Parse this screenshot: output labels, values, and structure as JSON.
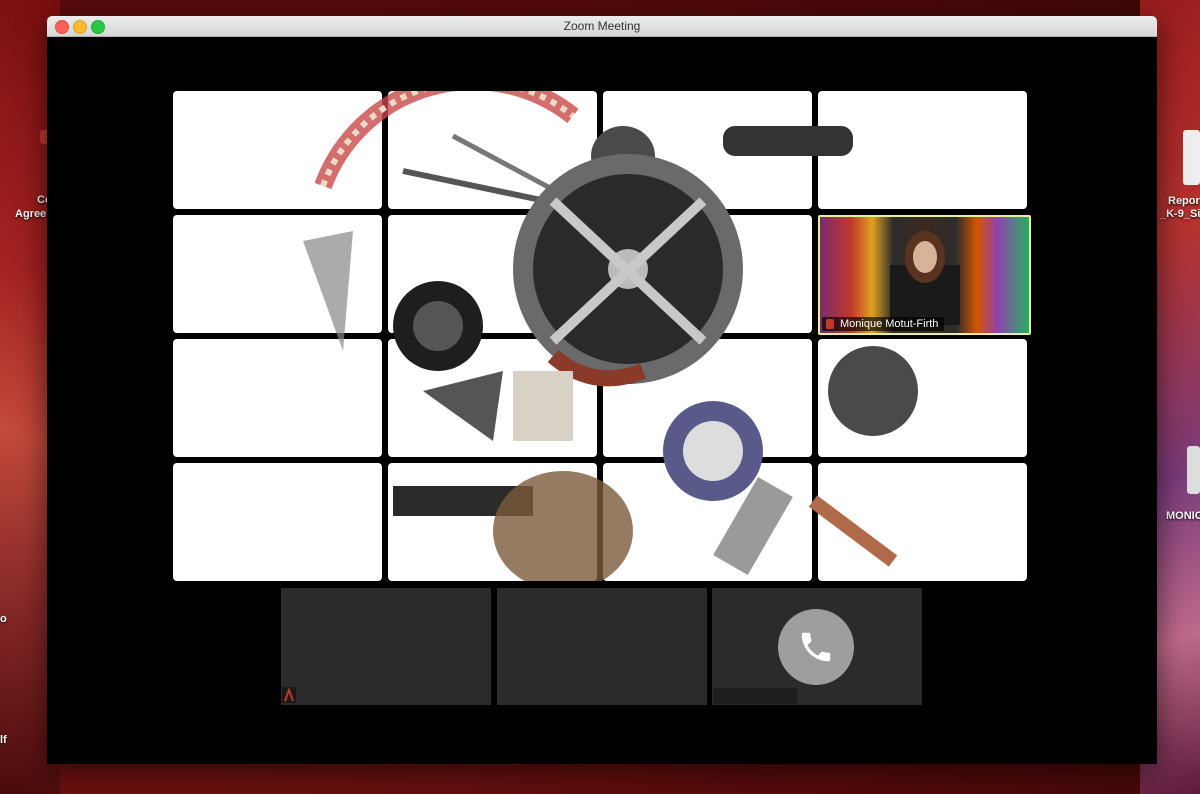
{
  "window": {
    "title": "Zoom Meeting"
  },
  "desktop": {
    "left_icon_label_1": "Co",
    "left_icon_label_2": "Agree",
    "right_icon_label_1": "Repor",
    "right_icon_label_2": "_K-9_Si",
    "right_drive_label": "MONIC",
    "left_small_1": "o",
    "left_small_2": "lf"
  },
  "gallery": {
    "active_speaker_name": "Monique Motut-Firth",
    "tiles_count": 16,
    "bottom_tiles_count": 3
  },
  "colors": {
    "highlight_border": "#e7ef9a",
    "call_button": "#9e9e9e"
  },
  "icons": {
    "call": "phone-icon"
  }
}
